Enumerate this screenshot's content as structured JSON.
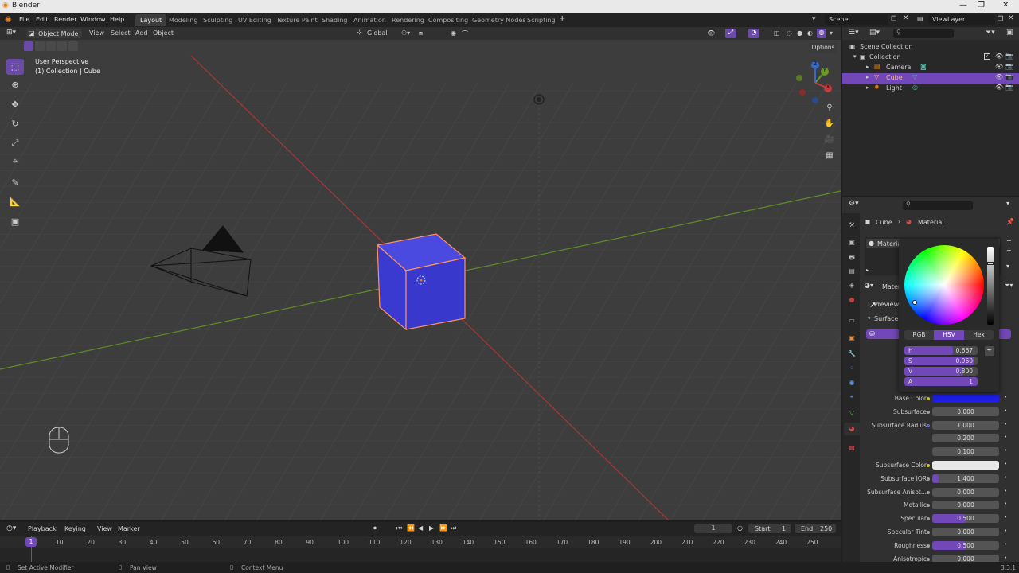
{
  "window": {
    "title": "Blender",
    "minimize": "—",
    "maximize": "❐",
    "close": "✕"
  },
  "menu": [
    "File",
    "Edit",
    "Render",
    "Window",
    "Help"
  ],
  "workspaces": [
    "Layout",
    "Modeling",
    "Sculpting",
    "UV Editing",
    "Texture Paint",
    "Shading",
    "Animation",
    "Rendering",
    "Compositing",
    "Geometry Nodes",
    "Scripting"
  ],
  "active_workspace": "Layout",
  "add_workspace": "+",
  "scene": {
    "name": "Scene",
    "view_layer": "ViewLayer"
  },
  "viewport_header": {
    "mode": "Object Mode",
    "menus": [
      "View",
      "Select",
      "Add",
      "Object"
    ],
    "orientation": "Global",
    "options": "Options"
  },
  "viewport": {
    "perspective": "User Perspective",
    "collection_info": "(1) Collection | Cube",
    "axis_x": "X",
    "axis_y": "Y",
    "axis_z": "Z"
  },
  "outliner": {
    "scene_collection": "Scene Collection",
    "collection": "Collection",
    "items": [
      "Camera",
      "Cube",
      "Light"
    ],
    "selected": "Cube"
  },
  "properties": {
    "breadcrumb_object": "Cube",
    "breadcrumb_tab": "Material",
    "slot_name": "Materia",
    "material_row": "Materi",
    "preview": "Preview",
    "surface": "Surface",
    "params": [
      {
        "label": "Base Color",
        "value": "",
        "dot": "#c7c729",
        "field": "#1e1ee6"
      },
      {
        "label": "Subsurface",
        "value": "0.000",
        "dot": "#a1a1a1"
      },
      {
        "label": "Subsurface Radius",
        "value": "1.000",
        "dot": "#6363c7"
      },
      {
        "label": "",
        "value": "0.200"
      },
      {
        "label": "",
        "value": "0.100"
      },
      {
        "label": "Subsurface Color",
        "value": "",
        "dot": "#c7c729",
        "field": "#e8e8e8"
      },
      {
        "label": "Subsurface IOR",
        "value": "1.400",
        "dot": "#a1a1a1",
        "fill": 0.1
      },
      {
        "label": "Subsurface Anisot...",
        "value": "0.000",
        "dot": "#a1a1a1"
      },
      {
        "label": "Metallic",
        "value": "0.000",
        "dot": "#a1a1a1"
      },
      {
        "label": "Specular",
        "value": "0.500",
        "dot": "#a1a1a1",
        "fill": 0.5
      },
      {
        "label": "Specular Tint",
        "value": "0.000",
        "dot": "#a1a1a1"
      },
      {
        "label": "Roughness",
        "value": "0.500",
        "dot": "#a1a1a1",
        "fill": 0.5
      },
      {
        "label": "Anisotropic",
        "value": "0.000",
        "dot": "#a1a1a1"
      }
    ]
  },
  "color_picker": {
    "modes": [
      "RGB",
      "HSV",
      "Hex"
    ],
    "active_mode": "HSV",
    "fields": [
      {
        "label": "H",
        "value": "0.667",
        "fill": 0.667
      },
      {
        "label": "S",
        "value": "0.960",
        "fill": 0.96
      },
      {
        "label": "V",
        "value": "0.800",
        "fill": 0.8
      },
      {
        "label": "A",
        "value": "1",
        "fill": 1.0
      }
    ]
  },
  "timeline": {
    "menus": [
      "Playback",
      "Keying",
      "View",
      "Marker"
    ],
    "current_frame": "1",
    "start_label": "Start",
    "start": "1",
    "end_label": "End",
    "end": "250",
    "ticks": [
      "10",
      "20",
      "30",
      "40",
      "50",
      "60",
      "70",
      "80",
      "90",
      "100",
      "110",
      "120",
      "130",
      "140",
      "150",
      "160",
      "170",
      "180",
      "190",
      "200",
      "210",
      "220",
      "230",
      "240",
      "250"
    ],
    "playhead": "1"
  },
  "status": {
    "left": "Set Active Modifier",
    "middle": "Pan View",
    "right": "Context Menu",
    "version": "3.3.1"
  },
  "colors": {
    "accent": "#7248b8",
    "selection_orange": "#ff9060",
    "cube": "#3b3bd6",
    "x_axis": "#c23c3c",
    "y_axis": "#6a9a2a"
  }
}
